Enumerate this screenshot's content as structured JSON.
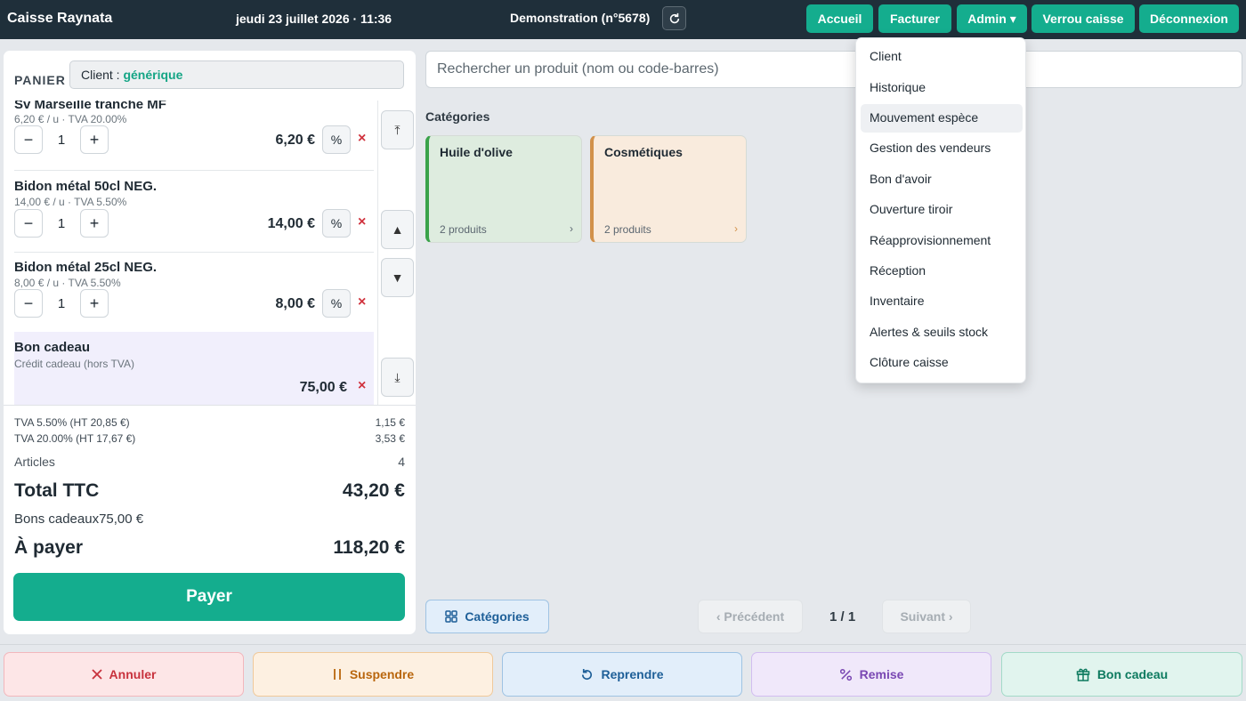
{
  "header": {
    "brand": "Caisse Raynata",
    "datetime": "jeudi 23 juillet 2026 · 11:36",
    "register": "Demonstration (n°5678)",
    "nav": [
      "Accueil",
      "Facturer",
      "Admin ▾",
      "Verrou caisse",
      "Déconnexion"
    ]
  },
  "cart": {
    "label": "PANIER",
    "client_prefix": "Client : ",
    "client_name": "générique",
    "items": [
      {
        "name": "Sv Marseille tranche MF",
        "sub": "6,20 € / u · TVA 20.00%",
        "qty": "1",
        "price": "6,20 €"
      },
      {
        "name": "Bidon métal 50cl NEG.",
        "sub": "14,00 € / u · TVA 5.50%",
        "qty": "1",
        "price": "14,00 €"
      },
      {
        "name": "Bidon métal 25cl NEG.",
        "sub": "8,00 € / u · TVA 5.50%",
        "qty": "1",
        "price": "8,00 €"
      }
    ],
    "gift": {
      "name": "Bon cadeau",
      "sub": "Crédit cadeau (hors TVA)",
      "price": "75,00 €"
    },
    "controls": {
      "minus": "−",
      "plus": "+",
      "percent": "%",
      "remove": "×"
    },
    "scroll": {
      "top": "⤒",
      "up": "▲",
      "down": "▼",
      "bottom": "⤓"
    },
    "totals": {
      "tva1_label": "TVA 5.50% (HT 20,85 €)",
      "tva1_value": "1,15 €",
      "tva2_label": "TVA 20.00% (HT 17,67 €)",
      "tva2_value": "3,53 €",
      "articles_label": "Articles",
      "articles_value": "4",
      "ttc_label": "Total TTC",
      "ttc_value": "43,20 €",
      "gift_label": "Bons cadeaux",
      "gift_value": "75,00 €",
      "pay_label": "À payer",
      "pay_value": "118,20 €"
    },
    "pay_button": "Payer"
  },
  "search": {
    "placeholder": "Rechercher un produit (nom ou code-barres)"
  },
  "categories": {
    "title": "Catégories",
    "items": [
      {
        "name": "Huile d'olive",
        "count": "2 produits",
        "color": "#3aa24a"
      },
      {
        "name": "Cosmétiques",
        "count": "2 produits",
        "color": "#d2914a"
      }
    ],
    "chevron": "›"
  },
  "pager": {
    "categories_button": "Catégories",
    "prev": "‹ Précédent",
    "page": "1 / 1",
    "next": "Suivant ›"
  },
  "actions": [
    "Annuler",
    "Suspendre",
    "Reprendre",
    "Remise",
    "Bon cadeau"
  ],
  "admin_menu": {
    "items": [
      "Client",
      "Historique",
      "Mouvement espèce",
      "Gestion des vendeurs",
      "Bon d'avoir",
      "Ouverture tiroir",
      "Réapprovisionnement",
      "Réception",
      "Inventaire",
      "Alertes & seuils stock",
      "Clôture caisse"
    ],
    "highlighted": "Mouvement espèce"
  },
  "colors": {
    "accent": "#14ad8e",
    "header": "#1f2f3a",
    "danger": "#d0323d"
  }
}
